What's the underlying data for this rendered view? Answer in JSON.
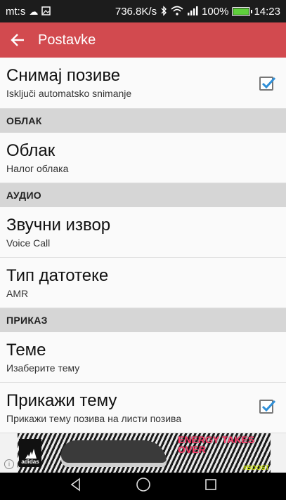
{
  "status_bar": {
    "carrier": "mt:s",
    "net_speed": "736.8K/s",
    "battery_pct": "100%",
    "time": "14:23"
  },
  "app_bar": {
    "title": "Postavke"
  },
  "prefs": {
    "record_calls": {
      "title": "Снимај позиве",
      "summary": "Isključi automatsko snimanje",
      "checked": true
    },
    "cloud_header": "ОБЛАК",
    "cloud": {
      "title": "Облак",
      "summary": "Налог облака"
    },
    "audio_header": "АУДИО",
    "sound_source": {
      "title": "Звучни извор",
      "summary": "Voice Call"
    },
    "file_type": {
      "title": "Тип датотеке",
      "summary": "AMR"
    },
    "display_header": "ПРИКАЗ",
    "themes": {
      "title": "Теме",
      "summary": "Изаберите тему"
    },
    "show_theme": {
      "title": "Прикажи тему",
      "summary": "Прикажи тему позива на листи позива",
      "checked": true
    }
  },
  "ad": {
    "brand": "adidas",
    "headline": "ENERGY TAKES OVER",
    "tag": "#BOOST"
  },
  "colors": {
    "accent": "#d24a4f",
    "checkbox": "#2f8fd8"
  }
}
